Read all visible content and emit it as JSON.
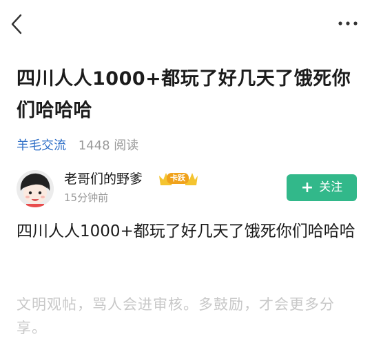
{
  "post": {
    "title": "四川人人1000+都玩了好几天了饿死你们哈哈哈",
    "category": "羊毛交流",
    "reads": "1448 阅读",
    "content": "四川人人1000+都玩了好几天了饿死你们哈哈哈"
  },
  "author": {
    "name": "老哥们的野爹",
    "badge": "卡跃",
    "time": "15分钟前"
  },
  "follow": {
    "label": "关注",
    "plus": "+",
    "color": "#32b88a"
  },
  "comment": {
    "hint": "文明观帖，骂人会进审核。多鼓励，才会更多分享。"
  },
  "colors": {
    "category": "#2f6fc7",
    "muted": "#9a9a9a",
    "hint": "#c8c8c8"
  },
  "icons": {
    "back": "chevron-left-icon",
    "more": "more-dots-icon",
    "badge": "crown-badge-icon"
  }
}
